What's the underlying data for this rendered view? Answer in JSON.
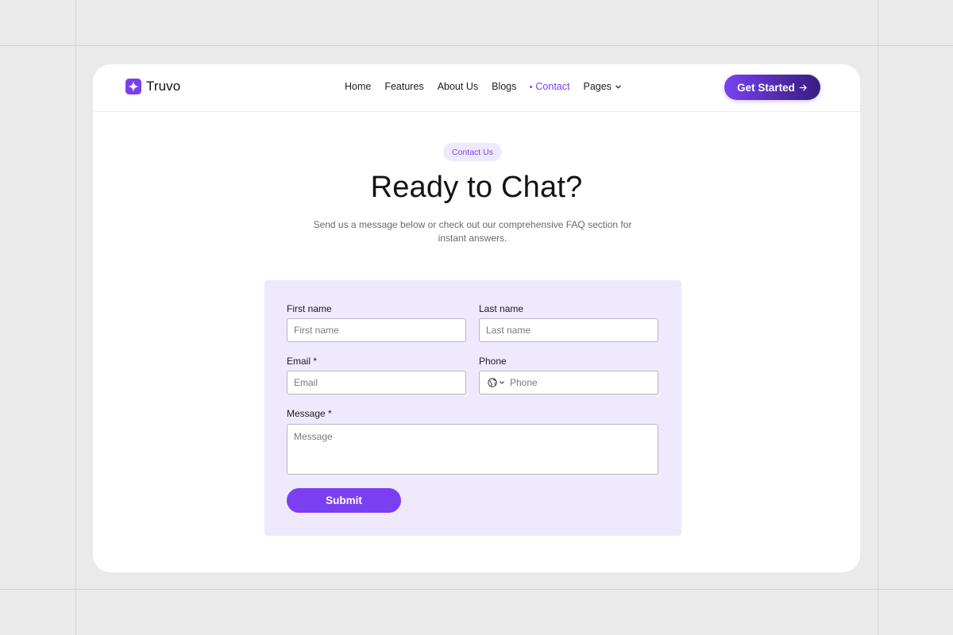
{
  "brand": {
    "name": "Truvo",
    "accent_color": "#7b3ff2",
    "logo_icon": "four-point-star-icon"
  },
  "nav": {
    "items": [
      {
        "label": "Home"
      },
      {
        "label": "Features"
      },
      {
        "label": "About Us"
      },
      {
        "label": "Blogs"
      },
      {
        "label": "Contact",
        "active": true
      },
      {
        "label": "Pages",
        "has_dropdown": true
      }
    ],
    "cta_label": "Get Started",
    "cta_icon": "arrow-right-icon"
  },
  "hero": {
    "badge": "Contact Us",
    "title": "Ready to Chat?",
    "subtitle": "Send us a message below or check out our comprehensive FAQ section for instant answers."
  },
  "form": {
    "panel_color": "#efe9fd",
    "first_name": {
      "label": "First name",
      "placeholder": "First name",
      "value": ""
    },
    "last_name": {
      "label": "Last name",
      "placeholder": "Last name",
      "value": ""
    },
    "email": {
      "label": "Email *",
      "placeholder": "Email",
      "value": ""
    },
    "phone": {
      "label": "Phone",
      "placeholder": "Phone",
      "value": "",
      "country_icon": "globe-icon"
    },
    "message": {
      "label": "Message *",
      "placeholder": "Message",
      "value": ""
    },
    "submit_label": "Submit"
  }
}
